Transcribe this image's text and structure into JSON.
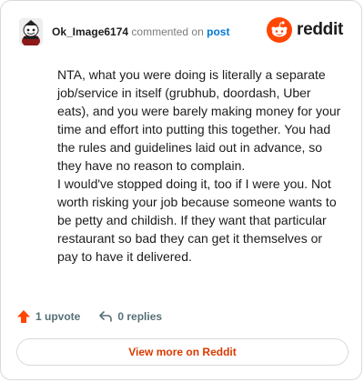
{
  "header": {
    "username": "Ok_Image6174",
    "commented_text": "commented on",
    "post_link": "post",
    "brand_name": "reddit"
  },
  "comment": {
    "paragraphs": [
      "NTA, what you were doing is literally a separate job/service in itself (grubhub, doordash, Uber eats), and you were barely making money for your time and effort into putting this together. You had the rules and guidelines laid out in advance, so they have no reason to complain.",
      "I would've stopped doing it, too if I were you. Not worth risking your job because someone wants to be petty and childish. If they want that particular restaurant so bad they can get it themselves or pay to have it delivered."
    ]
  },
  "actions": {
    "upvote_label": "1 upvote",
    "reply_label": "0 replies"
  },
  "footer": {
    "view_more_label": "View more on Reddit"
  },
  "icons": {
    "avatar": "snoo-avatar-icon",
    "brand": "reddit-logo-icon",
    "upvote": "upvote-arrow-icon",
    "reply": "reply-arrow-icon"
  },
  "colors": {
    "brand_orange": "#ff4500",
    "link_blue": "#0079d3",
    "muted_text": "#7c7c7c",
    "action_text": "#576f76",
    "view_more_text": "#d93a00",
    "border": "#d7dadc"
  }
}
